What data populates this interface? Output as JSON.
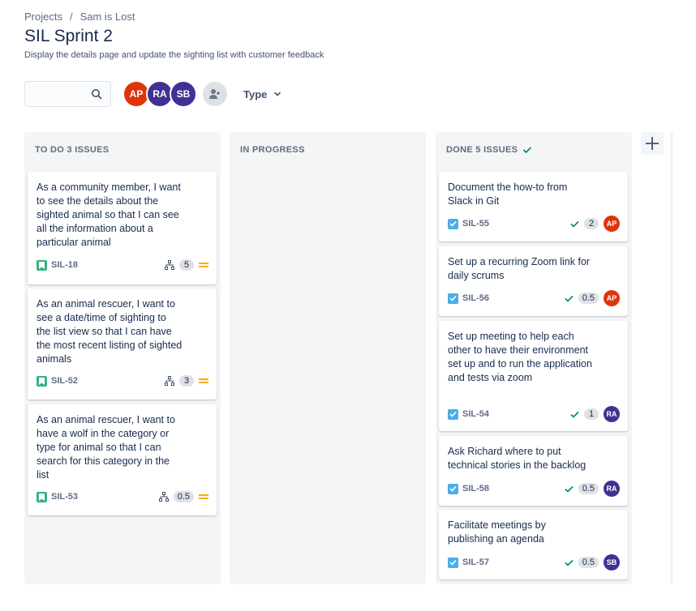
{
  "breadcrumb": {
    "project": "Projects",
    "separator": "/",
    "board": "Sam is Lost"
  },
  "title": "SIL Sprint 2",
  "subtitle": "Display the details page and update the sighting list with customer feedback",
  "toolbar": {
    "search_placeholder": "",
    "avatars": [
      {
        "initials": "AP",
        "color": "#de350b"
      },
      {
        "initials": "RA",
        "color": "#403294"
      },
      {
        "initials": "SB",
        "color": "#403294"
      }
    ],
    "type_label": "Type"
  },
  "columns": [
    {
      "title": "TO DO 3 ISSUES",
      "cards": [
        {
          "summary": "As a community member, I want to see the details about the sighted animal so that I can see all the information about a particular animal",
          "key": "SIL-18",
          "points": "5",
          "type": "story"
        },
        {
          "summary": "As an animal rescuer, I want to see a date/time of sighting to the list view so that I can have the most recent listing of sighted animals",
          "key": "SIL-52",
          "points": "3",
          "type": "story"
        },
        {
          "summary": "As an animal rescuer, I want to have a wolf in the category or type for animal so that I can search for this category in the list",
          "key": "SIL-53",
          "points": "0.5",
          "type": "story"
        }
      ]
    },
    {
      "title": "IN PROGRESS",
      "cards": []
    },
    {
      "title": "DONE 5 ISSUES",
      "cards": [
        {
          "summary": "Document the how-to from Slack in Git",
          "key": "SIL-55",
          "points": "2",
          "assignee": "AP",
          "assignee_color": "#de350b",
          "type": "task"
        },
        {
          "summary": "Set up a recurring Zoom link for daily scrums",
          "key": "SIL-56",
          "points": "0.5",
          "assignee": "AP",
          "assignee_color": "#de350b",
          "type": "task"
        },
        {
          "summary": "Set up meeting to help each other to have their environment set up and to run the application and tests via zoom",
          "key": "SIL-54",
          "points": "1",
          "assignee": "RA",
          "assignee_color": "#403294",
          "type": "task"
        },
        {
          "summary": "Ask Richard where to put technical stories in the backlog",
          "key": "SIL-58",
          "points": "0.5",
          "assignee": "RA",
          "assignee_color": "#403294",
          "type": "task"
        },
        {
          "summary": "Facilitate meetings by publishing an agenda",
          "key": "SIL-57",
          "points": "0.5",
          "assignee": "SB",
          "assignee_color": "#403294",
          "type": "task"
        }
      ]
    }
  ],
  "colors": {
    "story": "#36b37e",
    "task": "#4bade8",
    "done_check": "#00875a",
    "priority_medium": "#ffab00"
  }
}
